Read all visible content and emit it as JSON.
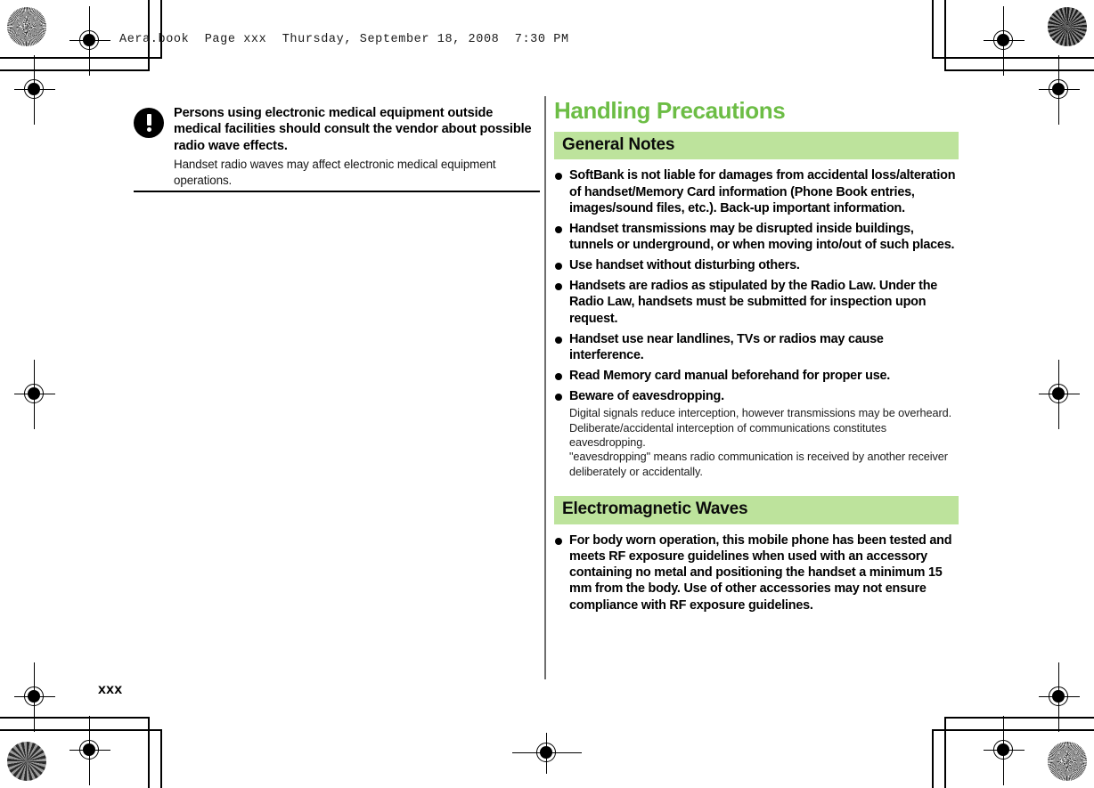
{
  "print_header": {
    "file_info": "Aera.book  Page xxx  Thursday, September 18, 2008  7:30 PM"
  },
  "colors": {
    "title_green": "#6cbd45",
    "section_bar_green": "#bde39c",
    "rule_black": "#000000",
    "divider_gray": "#6e6e6e"
  },
  "left_column": {
    "warning": {
      "icon": "exclamation-circle-icon",
      "heading": "Persons using electronic medical equipment outside medical facilities should consult the vendor about possible radio wave effects.",
      "body": "Handset radio waves may affect electronic medical equipment operations."
    }
  },
  "right_column": {
    "title": "Handling Precautions",
    "sections": [
      {
        "heading": "General Notes",
        "items": [
          {
            "text": "SoftBank is not liable for damages from accidental loss/alteration of handset/Memory Card information (Phone Book entries, images/sound files, etc.). Back-up important information."
          },
          {
            "text": "Handset transmissions may be disrupted inside buildings, tunnels or underground, or when moving into/out of such places."
          },
          {
            "text": "Use handset without disturbing others."
          },
          {
            "text": "Handsets are radios as stipulated by the Radio Law. Under the Radio Law, handsets must be submitted for inspection upon request."
          },
          {
            "text": "Handset use near landlines, TVs or radios may cause interference."
          },
          {
            "text": "Read Memory card manual beforehand for proper use."
          },
          {
            "text": "Beware of eavesdropping.",
            "note_line_1": "Digital signals reduce interception, however transmissions may be overheard. Deliberate/accidental interception of communications constitutes eavesdropping.",
            "note_line_2": "\"eavesdropping\" means radio communication is received by another receiver deliberately or accidentally."
          }
        ]
      },
      {
        "heading": "Electromagnetic Waves",
        "items": [
          {
            "text": "For body worn operation, this mobile phone has been tested and meets RF exposure guidelines when used with an accessory containing no metal and positioning the handset a minimum 15 mm from the body. Use of other accessories may not ensure compliance with RF exposure guidelines."
          }
        ]
      }
    ]
  },
  "footer": {
    "page_number": "xxx"
  }
}
